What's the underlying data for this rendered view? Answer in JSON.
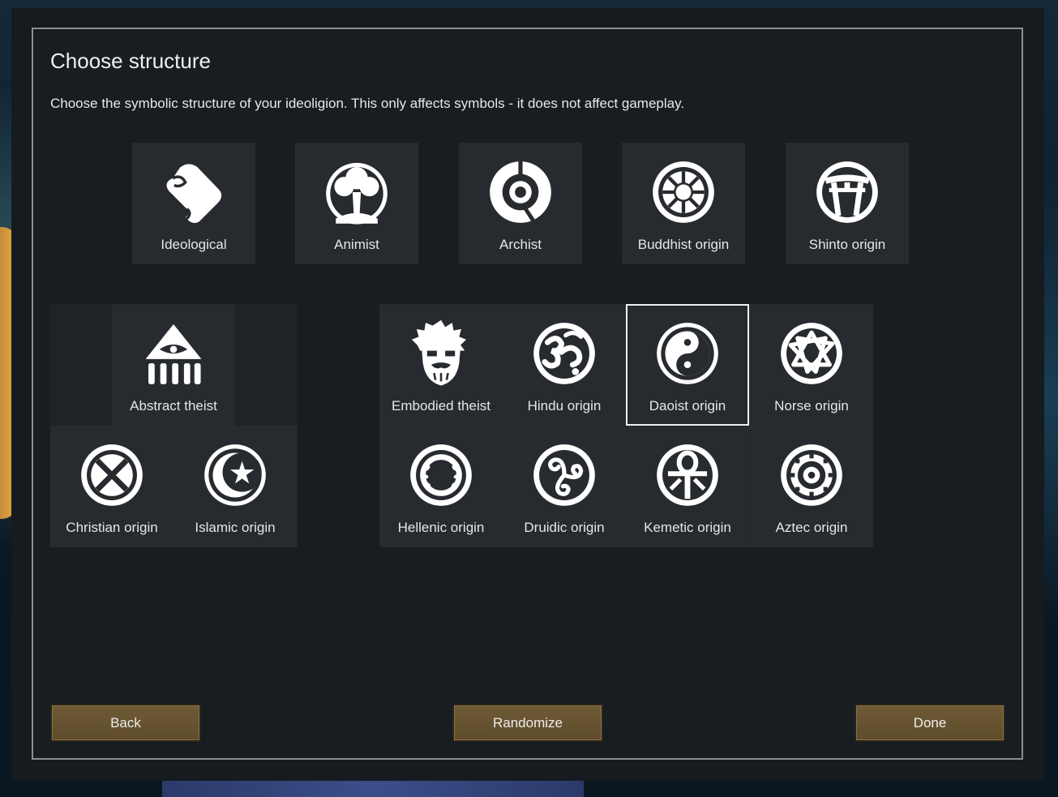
{
  "dialog": {
    "title": "Choose structure",
    "description": "Choose the symbolic structure of your ideoligion. This only affects symbols - it does not affect gameplay."
  },
  "top_row": [
    {
      "label": "Ideological",
      "icon": "scroll-icon"
    },
    {
      "label": "Animist",
      "icon": "tree-icon"
    },
    {
      "label": "Archist",
      "icon": "archist-icon"
    },
    {
      "label": "Buddhist origin",
      "icon": "dharma-wheel-icon"
    },
    {
      "label": "Shinto origin",
      "icon": "torii-icon"
    }
  ],
  "abstract_group": [
    {
      "label": "Abstract theist",
      "icon": "eye-pyramid-icon"
    },
    {
      "label": "Christian origin",
      "icon": "cross-circle-icon"
    },
    {
      "label": "Islamic origin",
      "icon": "crescent-star-icon"
    }
  ],
  "embodied_group": [
    {
      "label": "Embodied theist",
      "icon": "bearded-face-icon"
    },
    {
      "label": "Hindu origin",
      "icon": "om-icon"
    },
    {
      "label": "Daoist origin",
      "icon": "yin-yang-icon",
      "selected": true
    },
    {
      "label": "Norse origin",
      "icon": "valknut-icon"
    },
    {
      "label": "Hellenic origin",
      "icon": "laurel-icon"
    },
    {
      "label": "Druidic origin",
      "icon": "triskelion-icon"
    },
    {
      "label": "Kemetic origin",
      "icon": "ankh-icon"
    },
    {
      "label": "Aztec origin",
      "icon": "aztec-sun-icon"
    }
  ],
  "buttons": {
    "back": "Back",
    "randomize": "Randomize",
    "done": "Done"
  },
  "colors": {
    "panel": "#181d21",
    "tile": "#272b2f",
    "button": "#6e5a36",
    "text": "#e6e6e6"
  }
}
